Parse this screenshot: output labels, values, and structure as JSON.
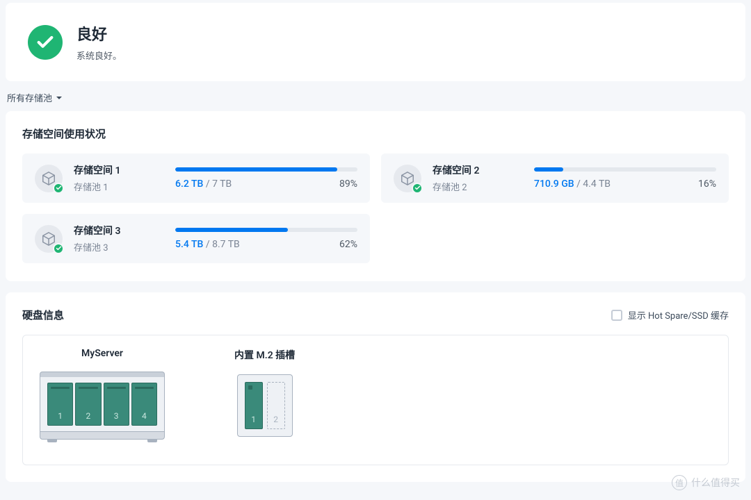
{
  "status": {
    "title": "良好",
    "subtitle": "系统良好。",
    "icon": "check-circle",
    "color": "#1fb573"
  },
  "filter": {
    "label": "所有存储池"
  },
  "usage": {
    "title": "存储空间使用状况",
    "volumes": [
      {
        "name": "存储空间 1",
        "pool": "存储池 1",
        "used": "6.2 TB",
        "total": "7 TB",
        "percent": "89%",
        "percent_num": 89
      },
      {
        "name": "存储空间 2",
        "pool": "存储池 2",
        "used": "710.9 GB",
        "total": "4.4 TB",
        "percent": "16%",
        "percent_num": 16
      },
      {
        "name": "存储空间 3",
        "pool": "存储池 3",
        "used": "5.4 TB",
        "total": "8.7 TB",
        "percent": "62%",
        "percent_num": 62
      }
    ]
  },
  "disks": {
    "title": "硬盘信息",
    "checkbox_label": "显示 Hot Spare/SSD 缓存",
    "devices": {
      "nas": {
        "name": "MyServer",
        "bays": [
          "1",
          "2",
          "3",
          "4"
        ]
      },
      "m2": {
        "name": "内置 M.2 插槽",
        "slots": [
          {
            "label": "1",
            "filled": true
          },
          {
            "label": "2",
            "filled": false
          }
        ]
      }
    }
  },
  "watermark": "什么值得买"
}
